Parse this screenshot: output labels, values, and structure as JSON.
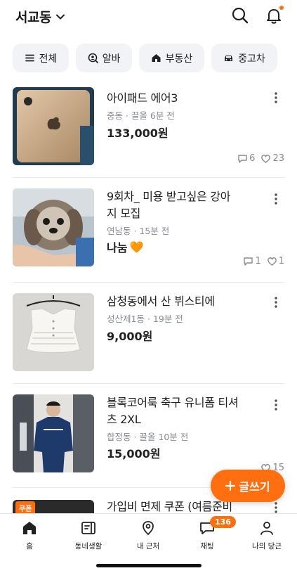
{
  "header": {
    "location": "서교동"
  },
  "chips": [
    {
      "label": "전체",
      "icon": "menu-icon"
    },
    {
      "label": "알바",
      "icon": "search-person-icon"
    },
    {
      "label": "부동산",
      "icon": "house-icon"
    },
    {
      "label": "중고차",
      "icon": "car-icon"
    }
  ],
  "items": [
    {
      "title": "아이패드 에어3",
      "meta": "중동 · 끌올 6분 전",
      "price": "133,000원",
      "chats": "6",
      "likes": "23"
    },
    {
      "title_line1": "9회차_ 미용 받고싶은 강아",
      "title_line2": "지 모집",
      "meta": "연남동 · 15분 전",
      "price": "나눔",
      "price_emoji": "🧡",
      "chats": "1",
      "likes": "1"
    },
    {
      "title": "삼청동에서 산 뷔스티에",
      "meta": "성산제1동 · 19분 전",
      "price": "9,000원"
    },
    {
      "title_line1": "블록코어룩 축구 유니폼 티셔",
      "title_line2": "츠 2XL",
      "meta": "합정동 · 끌올 10분 전",
      "price": "15,000원",
      "likes": "15"
    },
    {
      "title": "가입비 면제 쿠폰 (여름준비",
      "thumb_tag": "쿠폰"
    }
  ],
  "fab": {
    "label": "글쓰기"
  },
  "tabbar": {
    "tabs": [
      {
        "label": "홈",
        "icon": "home-icon"
      },
      {
        "label": "동네생활",
        "icon": "community-icon"
      },
      {
        "label": "내 근처",
        "icon": "location-pin-icon"
      },
      {
        "label": "채팅",
        "icon": "chat-icon",
        "badge": "136"
      },
      {
        "label": "나의 당근",
        "icon": "person-icon"
      }
    ]
  },
  "colors": {
    "accent": "#ff6f0f",
    "muted": "#868b94",
    "text": "#212124"
  }
}
